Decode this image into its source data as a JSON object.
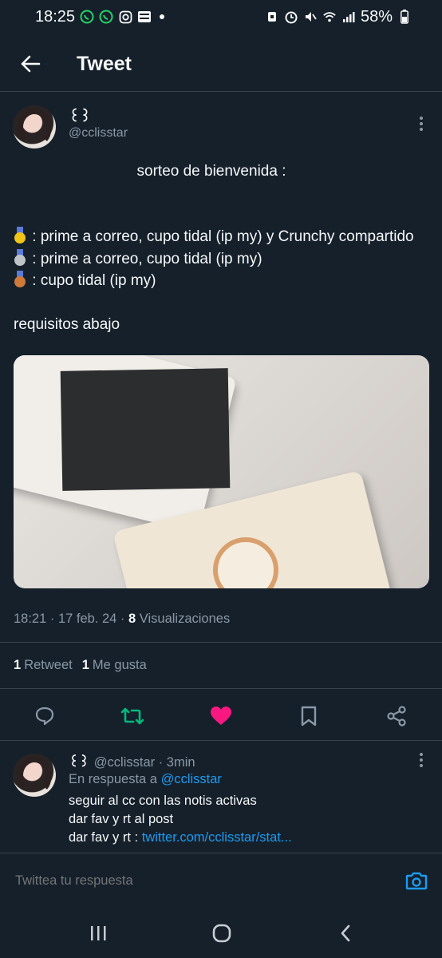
{
  "status_bar": {
    "time": "18:25",
    "battery": "58%",
    "icons_left": [
      "whatsapp-icon",
      "whatsapp-icon",
      "instagram-icon",
      "webtoon-icon",
      "dot-icon"
    ],
    "icons_right": [
      "alarm-icon",
      "clock-icon",
      "mute-icon",
      "wifi-icon",
      "signal-icon",
      "battery-icon"
    ]
  },
  "header": {
    "title": "Tweet"
  },
  "tweet": {
    "display_name": "꒰꒱",
    "handle": "@cclisstar",
    "line_title": "sorteo de bienvenida :",
    "line_gold": " : prime a correo, cupo tidal (ip my) y Crunchy compartido",
    "line_silver": " : prime a correo, cupo tidal (ip my)",
    "line_bronze": " : cupo tidal (ip my)",
    "line_req": "requisitos abajo",
    "meta_time": "18:21 · 17 feb. 24 · ",
    "views_count": "8",
    "views_label": " Visualizaciones",
    "retweets_count": "1",
    "retweets_label": "Retweet",
    "likes_count": "1",
    "likes_label": "Me gusta"
  },
  "reply": {
    "display_name": "꒰꒱",
    "handle": "@cclisstar · 3min",
    "in_reply_prefix": "En respuesta a ",
    "in_reply_handle": "@cclisstar",
    "line1": "seguir al cc con las notis activas",
    "line2": "dar fav y rt al post",
    "line3_prefix": "dar fav y rt : ",
    "line3_link": "twitter.com/cclisstar/stat..."
  },
  "composer": {
    "placeholder": "Twittea tu respuesta"
  },
  "colors": {
    "background": "#15202b",
    "accent": "#1d9bf0",
    "retweet_green": "#00ba7c",
    "like_pink": "#f91880",
    "muted": "#8b98a5"
  }
}
